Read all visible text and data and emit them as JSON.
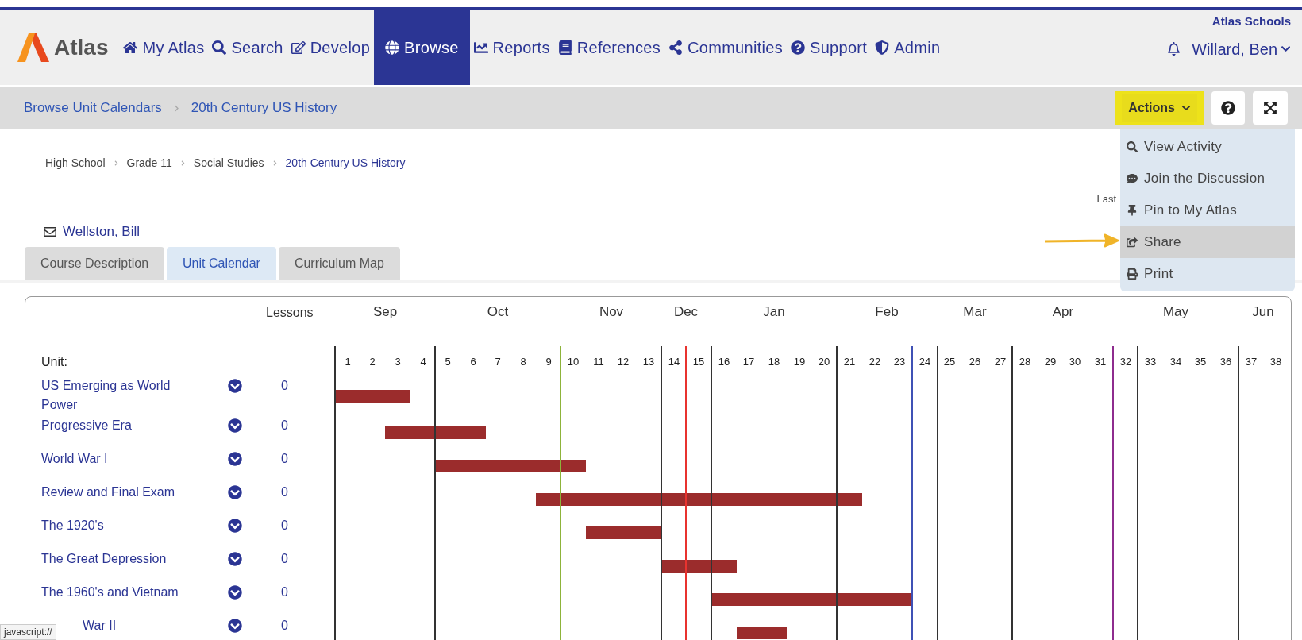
{
  "header": {
    "logo_text": "Atlas",
    "nav": [
      {
        "label": "My Atlas",
        "selected": false
      },
      {
        "label": "Search",
        "selected": false
      },
      {
        "label": "Develop",
        "selected": false
      },
      {
        "label": "Browse",
        "selected": true
      },
      {
        "label": "Reports",
        "selected": false
      },
      {
        "label": "References",
        "selected": false
      },
      {
        "label": "Communities",
        "selected": false
      },
      {
        "label": "Support",
        "selected": false
      },
      {
        "label": "Admin",
        "selected": false
      }
    ],
    "org": "Atlas Schools",
    "user": "Willard, Ben"
  },
  "subheader": {
    "breadcrumbs": [
      "Browse Unit Calendars",
      "20th Century US History"
    ],
    "actions_button": "Actions"
  },
  "actions_menu": [
    {
      "label": "View Activity",
      "selected": false
    },
    {
      "label": "Join the Discussion",
      "selected": false
    },
    {
      "label": "Pin to My Atlas",
      "selected": false
    },
    {
      "label": "Share",
      "selected": true
    },
    {
      "label": "Print",
      "selected": false
    }
  ],
  "course": {
    "breadcrumbs": [
      "High School",
      "Grade 11",
      "Social Studies",
      "20th Century US History"
    ],
    "last_updated": "Last",
    "teacher": "Wellston, Bill"
  },
  "tabs": [
    {
      "label": "Course Description",
      "selected": false
    },
    {
      "label": "Unit Calendar",
      "selected": true
    },
    {
      "label": "Curriculum Map",
      "selected": false
    }
  ],
  "calendar": {
    "lessons_header": "Lessons",
    "unit_header": "Unit:",
    "months": [
      {
        "label": "Sep"
      },
      {
        "label": "Oct"
      },
      {
        "label": "Nov"
      },
      {
        "label": "Dec"
      },
      {
        "label": "Jan"
      },
      {
        "label": "Feb"
      },
      {
        "label": "Mar"
      },
      {
        "label": "Apr"
      },
      {
        "label": "May"
      },
      {
        "label": "Jun"
      }
    ],
    "units": [
      {
        "name": "US Emerging as World Power",
        "lessons": "0",
        "cut_off": false
      },
      {
        "name": "Progressive Era",
        "lessons": "0",
        "cut_off": false
      },
      {
        "name": "World War I",
        "lessons": "0",
        "cut_off": false
      },
      {
        "name": "Review and Final Exam",
        "lessons": "0",
        "cut_off": false
      },
      {
        "name": "The 1920's",
        "lessons": "0",
        "cut_off": false
      },
      {
        "name": "The Great Depression",
        "lessons": "0",
        "cut_off": false
      },
      {
        "name": "The 1960's and Vietnam",
        "lessons": "0",
        "cut_off": false
      },
      {
        "name": "War II",
        "lessons": "0",
        "cut_off": true
      }
    ],
    "weeks": [
      {
        "label": "1"
      },
      {
        "label": "2"
      },
      {
        "label": "3"
      },
      {
        "label": "4",
        "color": "#333333"
      },
      {
        "label": "5"
      },
      {
        "label": "6"
      },
      {
        "label": "7"
      },
      {
        "label": "8"
      },
      {
        "label": "9",
        "color": "#8db33a"
      },
      {
        "label": "10"
      },
      {
        "label": "11"
      },
      {
        "label": "12"
      },
      {
        "label": "13",
        "color": "#333333"
      },
      {
        "label": "14",
        "color": "#e8332f"
      },
      {
        "label": "15",
        "color": "#333333"
      },
      {
        "label": "16"
      },
      {
        "label": "17"
      },
      {
        "label": "18"
      },
      {
        "label": "19"
      },
      {
        "label": "20",
        "color": "#333333"
      },
      {
        "label": "21"
      },
      {
        "label": "22"
      },
      {
        "label": "23",
        "color": "#3f51b5"
      },
      {
        "label": "24",
        "color": "#333333"
      },
      {
        "label": "25"
      },
      {
        "label": "26"
      },
      {
        "label": "27",
        "color": "#333333"
      },
      {
        "label": "28"
      },
      {
        "label": "29"
      },
      {
        "label": "30"
      },
      {
        "label": "31",
        "color": "#8e2c8e"
      },
      {
        "label": "32",
        "color": "#333333"
      },
      {
        "label": "33"
      },
      {
        "label": "34"
      },
      {
        "label": "35"
      },
      {
        "label": "36",
        "color": "#333333"
      },
      {
        "label": "37"
      },
      {
        "label": "38"
      }
    ]
  },
  "status_tooltip": "javascript://"
}
